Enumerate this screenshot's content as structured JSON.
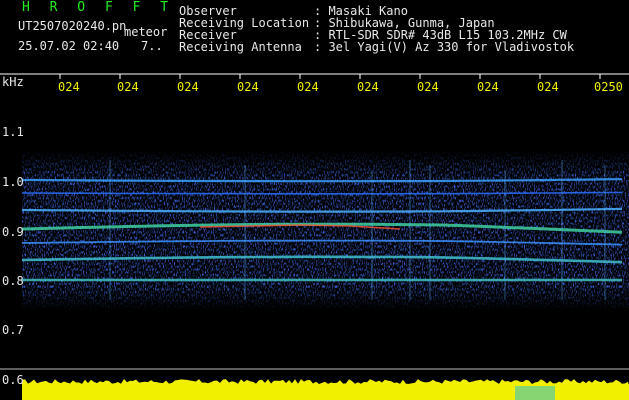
{
  "header": {
    "title": "H R O F F T",
    "filename": "UT2507020240.pn",
    "file_type": "meteor",
    "datetime": "25.07.02 02:40",
    "page_indicator": "7.."
  },
  "meta": {
    "observer_label": "Observer",
    "observer_value": ": Masaki Kano",
    "location_label": "Receiving Location",
    "location_value": ": Shibukawa, Gunma, Japan",
    "receiver_label": "Receiver",
    "receiver_value": ": RTL-SDR SDR# 43dB L15 103.2MHz CW",
    "antenna_label": "Receiving Antenna",
    "antenna_value": ": 3el Yagi(V) Az 330 for Vladivostok"
  },
  "y_axis": {
    "unit": "kHz",
    "ticks": [
      "1.1",
      "1.0",
      "0.9",
      "0.8",
      "0.7",
      "0.6"
    ]
  },
  "x_axis": {
    "ticks": [
      "024",
      "024",
      "024",
      "024",
      "024",
      "024",
      "024",
      "024",
      "024",
      "0250"
    ]
  },
  "colors": {
    "background": "#000000",
    "title": "#22ee22",
    "text": "#e8e8e8",
    "time_labels": "#f0f000",
    "noise_floor": "#f0f000"
  }
}
